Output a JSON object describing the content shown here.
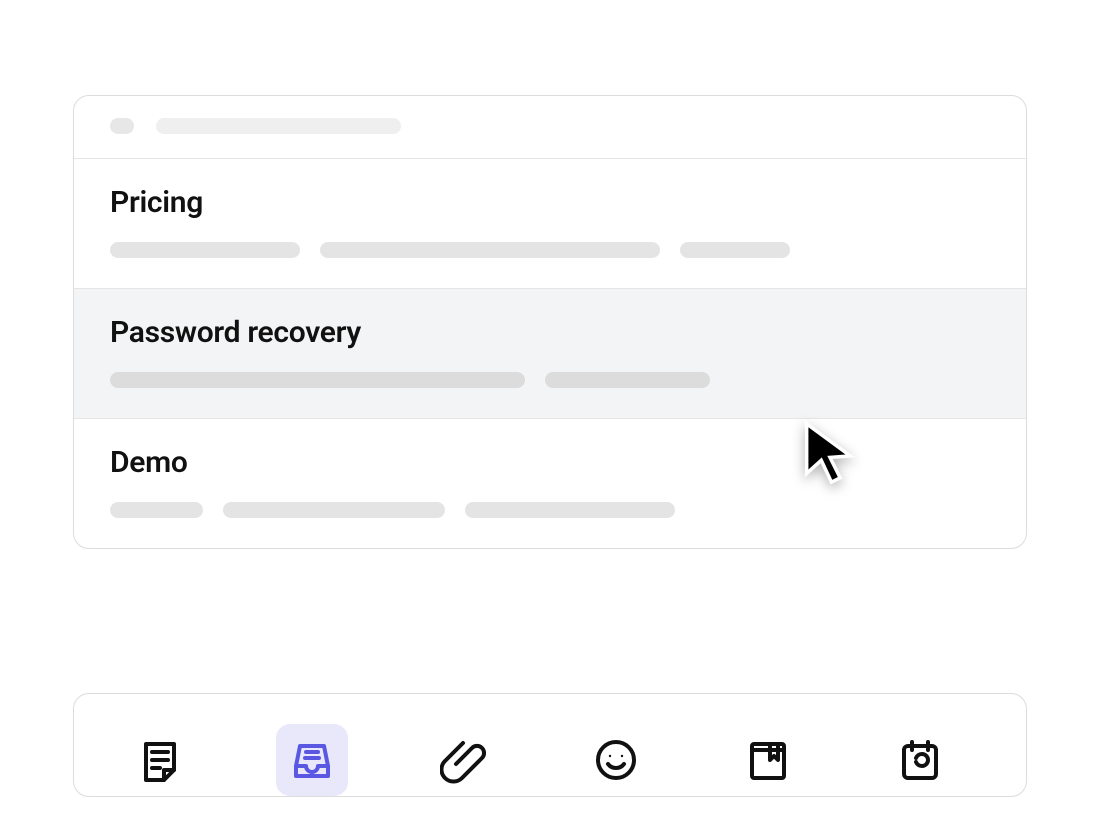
{
  "list": {
    "items": [
      {
        "title": "Pricing",
        "selected": false
      },
      {
        "title": "Password recovery",
        "selected": true
      },
      {
        "title": "Demo",
        "selected": false
      }
    ]
  },
  "toolbar": {
    "icons": [
      {
        "name": "note-icon",
        "active": false
      },
      {
        "name": "inbox-icon",
        "active": true
      },
      {
        "name": "attachment-icon",
        "active": false
      },
      {
        "name": "emoji-icon",
        "active": false
      },
      {
        "name": "bookmark-icon",
        "active": false
      },
      {
        "name": "calendar-icon",
        "active": false
      }
    ]
  },
  "colors": {
    "accent": "#5a57e3",
    "activeBg": "#e9e8fb",
    "selectedRow": "#f3f4f5"
  }
}
